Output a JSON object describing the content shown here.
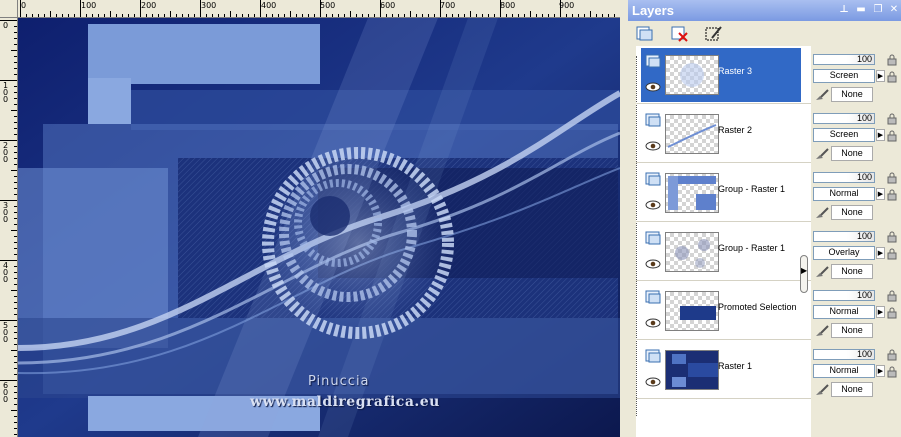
{
  "ruler": {
    "h_labels": [
      "0",
      "100",
      "200",
      "300",
      "400",
      "500",
      "600",
      "700",
      "800",
      "900"
    ],
    "v_labels": [
      "0",
      "100",
      "200",
      "300",
      "400",
      "500",
      "600"
    ]
  },
  "canvas": {
    "watermark_line1": "Pinuccia",
    "watermark_line2": "www.maldiregrafica.eu"
  },
  "panel": {
    "title": "Layers",
    "title_buttons": [
      "pin-icon",
      "dock-icon",
      "maximize-icon",
      "close-icon"
    ],
    "toolbar_tools": [
      "new-layer-icon",
      "delete-layer-icon",
      "layer-properties-icon"
    ]
  },
  "layers": [
    {
      "name": "Raster 3",
      "opacity": "100",
      "blend": "Screen",
      "mask": "None",
      "selected": true
    },
    {
      "name": "Raster 2",
      "opacity": "100",
      "blend": "Screen",
      "mask": "None",
      "selected": false
    },
    {
      "name": "Group - Raster 1",
      "opacity": "100",
      "blend": "Normal",
      "mask": "None",
      "selected": false
    },
    {
      "name": "Group - Raster 1",
      "opacity": "100",
      "blend": "Overlay",
      "mask": "None",
      "selected": false
    },
    {
      "name": "Promoted Selection",
      "opacity": "100",
      "blend": "Normal",
      "mask": "None",
      "selected": false
    },
    {
      "name": "Raster 1",
      "opacity": "100",
      "blend": "Normal",
      "mask": "None",
      "selected": false
    }
  ],
  "colors": {
    "selection": "#3169c6",
    "canvas_dark": "#15235a",
    "canvas_light": "#7fa1dc"
  }
}
